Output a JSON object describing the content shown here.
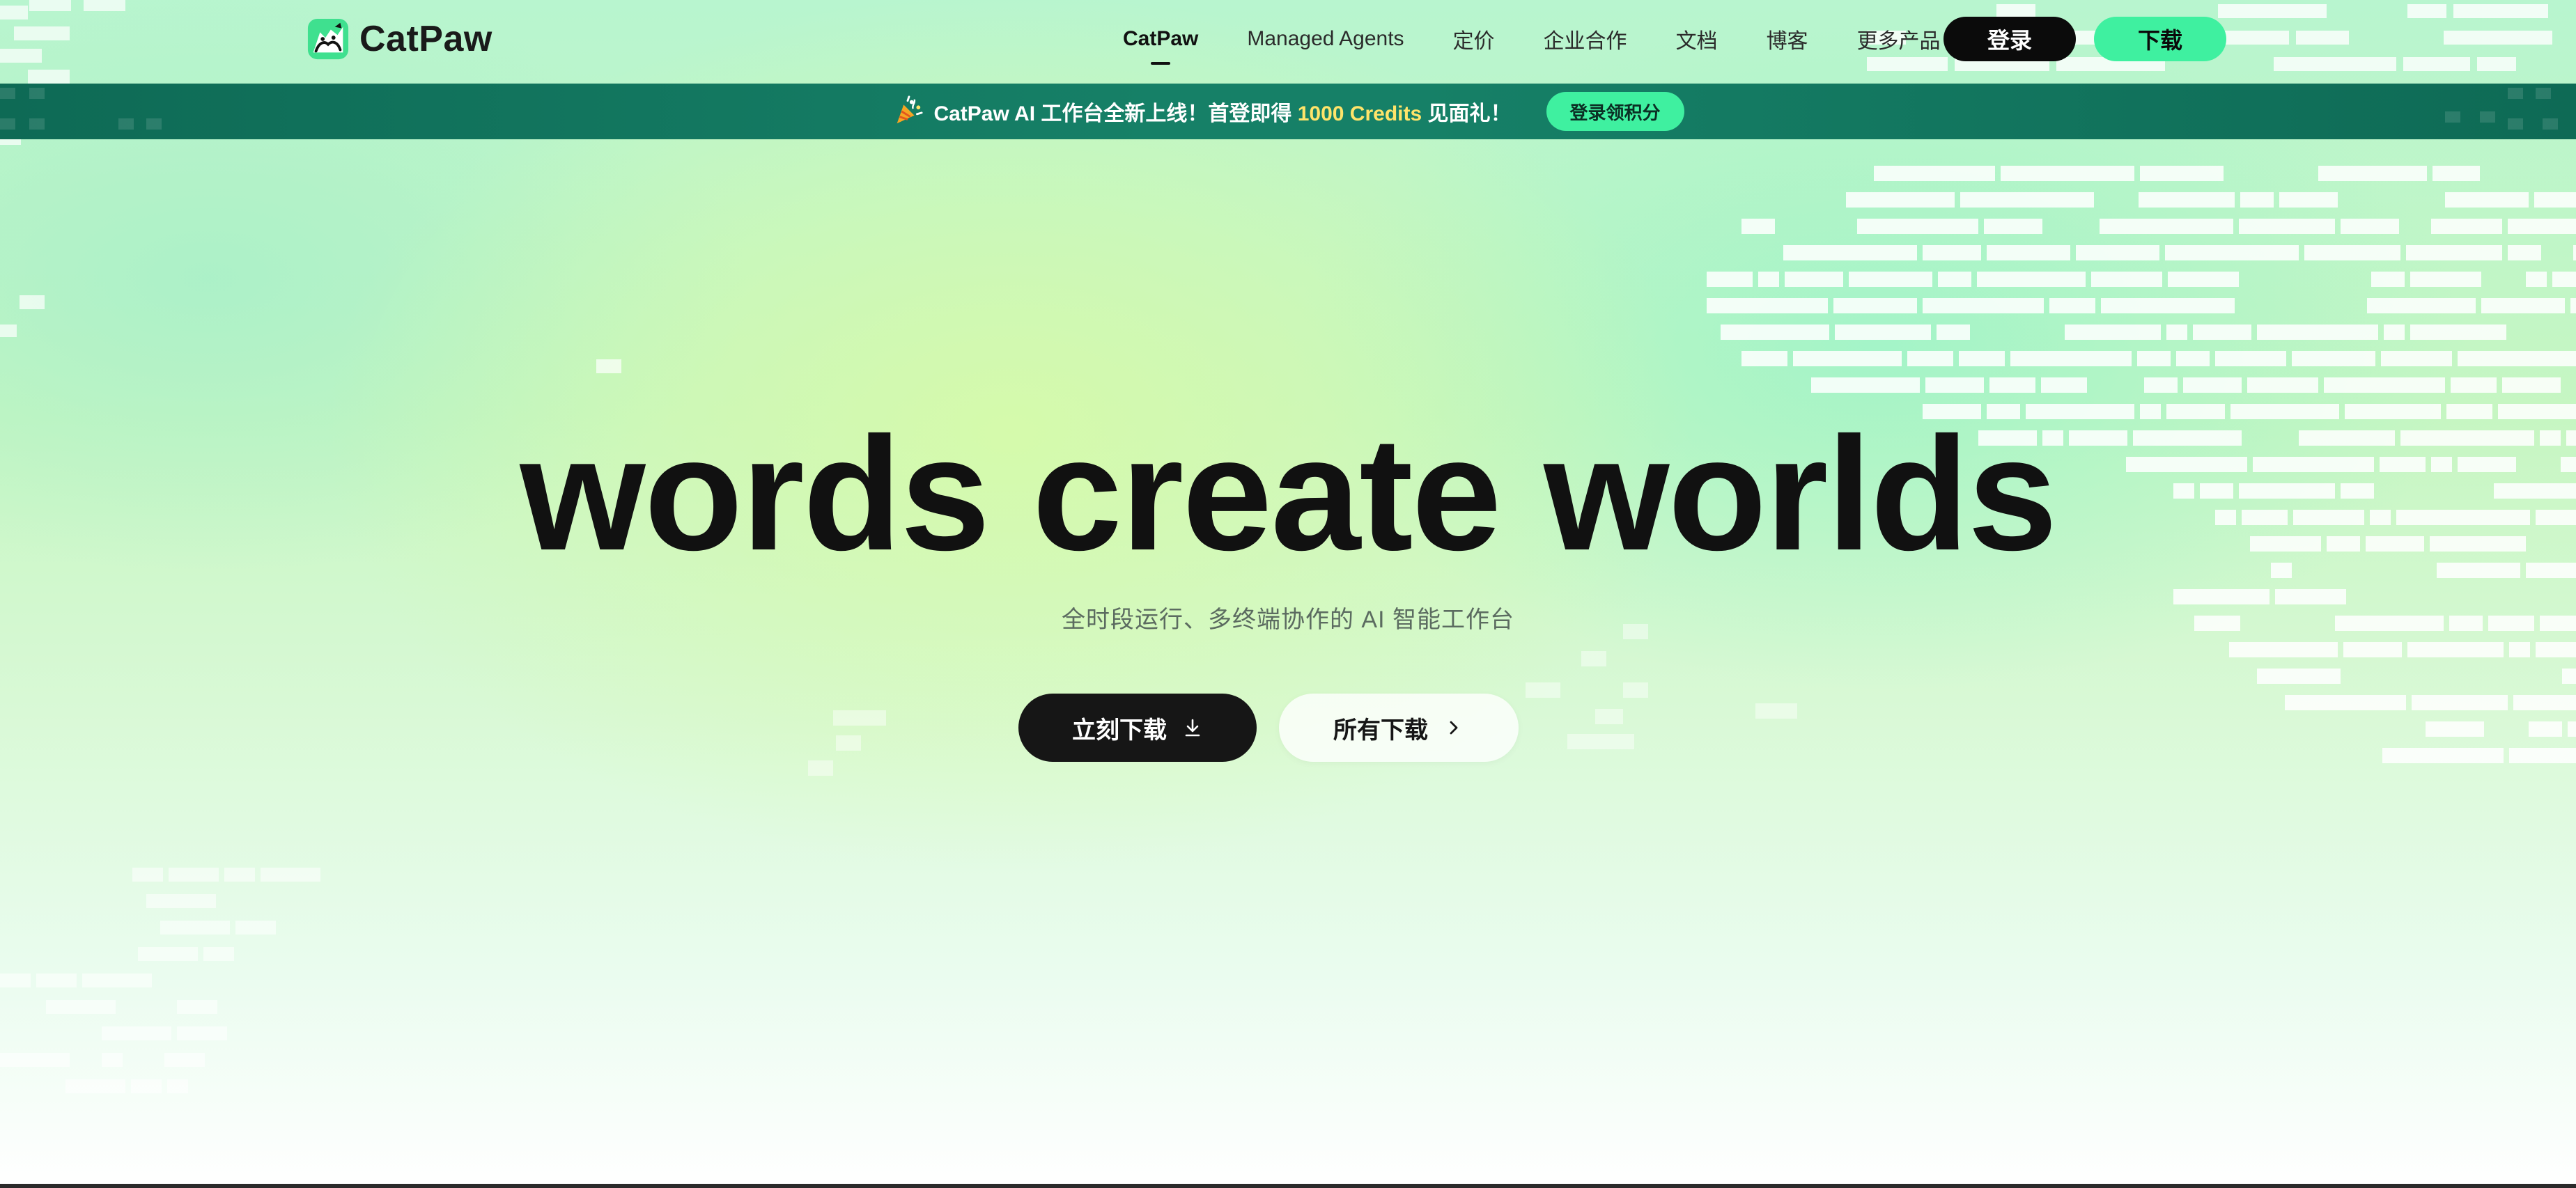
{
  "brand": {
    "name": "CatPaw",
    "logo_icon": "catpaw-logo-icon",
    "accent_color": "#3ff0a0"
  },
  "nav": {
    "items": [
      {
        "label": "CatPaw",
        "active": true
      },
      {
        "label": "Managed Agents",
        "active": false
      },
      {
        "label": "定价",
        "active": false
      },
      {
        "label": "企业合作",
        "active": false
      },
      {
        "label": "文档",
        "active": false
      },
      {
        "label": "博客",
        "active": false
      },
      {
        "label": "更多产品",
        "active": false
      }
    ],
    "login_label": "登录",
    "download_label": "下载"
  },
  "banner": {
    "icon": "party-popper-icon",
    "text_before": "CatPaw AI 工作台全新上线！首登即得",
    "highlight": "1000 Credits",
    "text_after": "见面礼！",
    "button_label": "登录领积分",
    "highlight_color": "#ffe46a"
  },
  "hero": {
    "title": "words create worlds",
    "subtitle": "全时段运行、多终端协作的 AI 智能工作台",
    "primary_button": {
      "label": "立刻下载",
      "icon": "download-arrow-icon"
    },
    "secondary_button": {
      "label": "所有下载",
      "icon": "chevron-right-icon"
    }
  }
}
